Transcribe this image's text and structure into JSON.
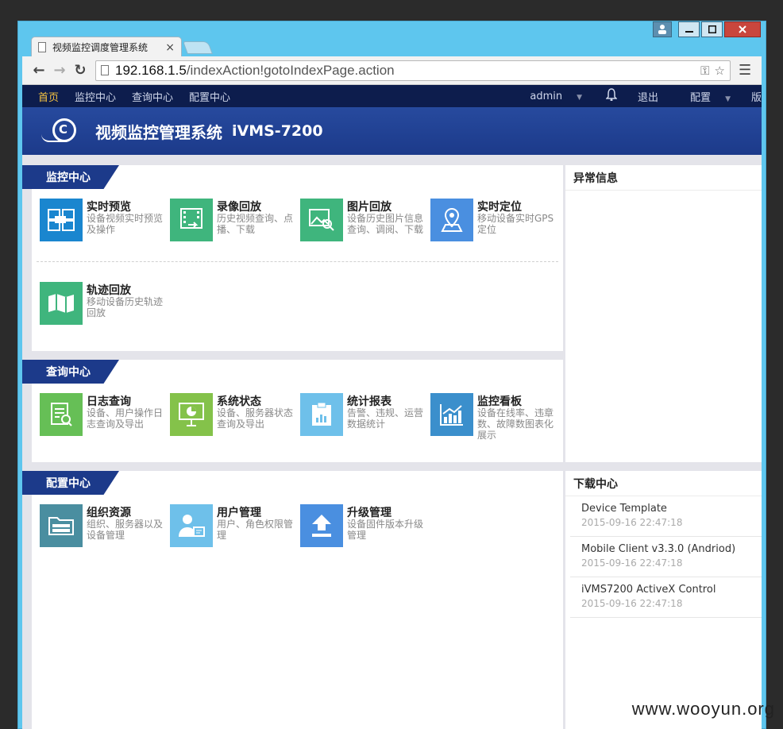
{
  "browser": {
    "tab_title": "视频监控调度管理系统",
    "tab_close": "×",
    "url_host": "192.168.1.5",
    "url_path": "/indexAction!gotoIndexPage.action"
  },
  "topnav": {
    "items": [
      "首页",
      "监控中心",
      "查询中心",
      "配置中心"
    ],
    "user": "admin",
    "logout": "退出",
    "config": "配置",
    "overflow": "版"
  },
  "header": {
    "title": "视频监控管理系统",
    "model": "iVMS-7200"
  },
  "sections": {
    "monitor": {
      "label": "监控中心",
      "tiles": [
        {
          "title": "实时预览",
          "desc": "设备视频实时预览及操作",
          "color": "#1a86cf"
        },
        {
          "title": "录像回放",
          "desc": "历史视频查询、点播、下载",
          "color": "#3fb57d"
        },
        {
          "title": "图片回放",
          "desc": "设备历史图片信息查询、调阅、下载",
          "color": "#3fb57d"
        },
        {
          "title": "实时定位",
          "desc": "移动设备实时GPS定位",
          "color": "#4a8fe0"
        },
        {
          "title": "轨迹回放",
          "desc": "移动设备历史轨迹回放",
          "color": "#3fb57d"
        }
      ]
    },
    "query": {
      "label": "查询中心",
      "tiles": [
        {
          "title": "日志查询",
          "desc": "设备、用户操作日志查询及导出",
          "color": "#66bf56"
        },
        {
          "title": "系统状态",
          "desc": "设备、服务器状态查询及导出",
          "color": "#84c24a"
        },
        {
          "title": "统计报表",
          "desc": "告警、违规、运营数据统计",
          "color": "#6ec0ea"
        },
        {
          "title": "监控看板",
          "desc": "设备在线率、违章数、故障数图表化展示",
          "color": "#3b8fcc"
        }
      ]
    },
    "config": {
      "label": "配置中心",
      "tiles": [
        {
          "title": "组织资源",
          "desc": "组织、服务器以及设备管理",
          "color": "#4a8ea0"
        },
        {
          "title": "用户管理",
          "desc": "用户、角色权限管理",
          "color": "#6ec0ea"
        },
        {
          "title": "升级管理",
          "desc": "设备固件版本升级管理",
          "color": "#4a8fe0"
        }
      ]
    }
  },
  "alerts": {
    "title": "异常信息"
  },
  "downloads": {
    "title": "下载中心",
    "items": [
      {
        "name": "Device Template",
        "time": "2015-09-16 22:47:18"
      },
      {
        "name": "Mobile Client v3.3.0 (Andriod)",
        "time": "2015-09-16 22:47:18"
      },
      {
        "name": "iVMS7200 ActiveX Control",
        "time": "2015-09-16 22:47:18"
      }
    ]
  },
  "watermark": "www.wooyun.org"
}
